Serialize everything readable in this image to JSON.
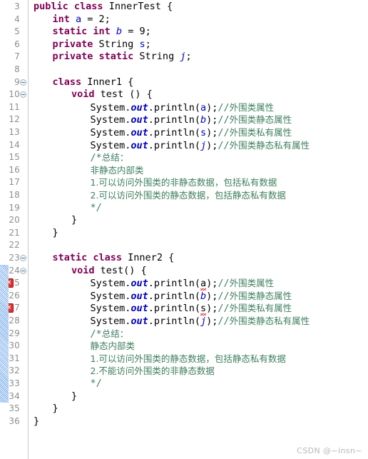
{
  "editor": {
    "language": "java",
    "first_line_number": 3,
    "last_line_number": 36,
    "colors": {
      "keyword": "#7f0055",
      "field": "#0000c0",
      "comment": "#3f7f5f",
      "error": "#e00000",
      "gutter_text": "#8e8e8e",
      "changebar": "#74a9e8",
      "background": "#ffffff"
    }
  },
  "lines": [
    {
      "n": "3",
      "fold": false,
      "error": false,
      "changed": false,
      "indent": 0,
      "tokens": [
        {
          "t": "kw",
          "v": "public"
        },
        {
          "t": "plain",
          "v": " "
        },
        {
          "t": "kw",
          "v": "class"
        },
        {
          "t": "plain",
          "v": " InnerTest {"
        }
      ]
    },
    {
      "n": "4",
      "fold": false,
      "error": false,
      "changed": false,
      "indent": 1,
      "tokens": [
        {
          "t": "kw",
          "v": "int"
        },
        {
          "t": "plain",
          "v": " "
        },
        {
          "t": "fld",
          "v": "a"
        },
        {
          "t": "plain",
          "v": " = 2;"
        }
      ]
    },
    {
      "n": "5",
      "fold": false,
      "error": false,
      "changed": false,
      "indent": 1,
      "tokens": [
        {
          "t": "kw",
          "v": "static int"
        },
        {
          "t": "plain",
          "v": " "
        },
        {
          "t": "sfld",
          "v": "b"
        },
        {
          "t": "plain",
          "v": " = 9;"
        }
      ]
    },
    {
      "n": "6",
      "fold": false,
      "error": false,
      "changed": false,
      "indent": 1,
      "tokens": [
        {
          "t": "kw",
          "v": "private"
        },
        {
          "t": "plain",
          "v": " String "
        },
        {
          "t": "fld",
          "v": "s"
        },
        {
          "t": "plain",
          "v": ";"
        }
      ]
    },
    {
      "n": "7",
      "fold": false,
      "error": false,
      "changed": false,
      "indent": 1,
      "tokens": [
        {
          "t": "kw",
          "v": "private static"
        },
        {
          "t": "plain",
          "v": " String "
        },
        {
          "t": "sfld",
          "v": "j"
        },
        {
          "t": "plain",
          "v": ";"
        }
      ]
    },
    {
      "n": "8",
      "fold": false,
      "error": false,
      "changed": false,
      "indent": 0,
      "tokens": []
    },
    {
      "n": "9",
      "fold": true,
      "error": false,
      "changed": false,
      "indent": 1,
      "tokens": [
        {
          "t": "kw",
          "v": "class"
        },
        {
          "t": "plain",
          "v": " Inner1 {"
        }
      ]
    },
    {
      "n": "10",
      "fold": true,
      "error": false,
      "changed": false,
      "indent": 2,
      "tokens": [
        {
          "t": "kw",
          "v": "void"
        },
        {
          "t": "plain",
          "v": " test () {"
        }
      ]
    },
    {
      "n": "11",
      "fold": false,
      "error": false,
      "changed": false,
      "indent": 3,
      "tokens": [
        {
          "t": "plain",
          "v": "System."
        },
        {
          "t": "mfld",
          "v": "out"
        },
        {
          "t": "plain",
          "v": ".println("
        },
        {
          "t": "fld",
          "v": "a"
        },
        {
          "t": "plain",
          "v": ");"
        },
        {
          "t": "cmtm",
          "v": "//"
        },
        {
          "t": "cmt",
          "v": "外围类属性"
        }
      ]
    },
    {
      "n": "12",
      "fold": false,
      "error": false,
      "changed": false,
      "indent": 3,
      "tokens": [
        {
          "t": "plain",
          "v": "System."
        },
        {
          "t": "mfld",
          "v": "out"
        },
        {
          "t": "plain",
          "v": ".println("
        },
        {
          "t": "sfld",
          "v": "b"
        },
        {
          "t": "plain",
          "v": ");"
        },
        {
          "t": "cmtm",
          "v": "//"
        },
        {
          "t": "cmt",
          "v": "外围类静态属性"
        }
      ]
    },
    {
      "n": "13",
      "fold": false,
      "error": false,
      "changed": false,
      "indent": 3,
      "tokens": [
        {
          "t": "plain",
          "v": "System."
        },
        {
          "t": "mfld",
          "v": "out"
        },
        {
          "t": "plain",
          "v": ".println("
        },
        {
          "t": "fld",
          "v": "s"
        },
        {
          "t": "plain",
          "v": ");"
        },
        {
          "t": "cmtm",
          "v": "//"
        },
        {
          "t": "cmt",
          "v": "外围类私有属性"
        }
      ]
    },
    {
      "n": "14",
      "fold": false,
      "error": false,
      "changed": false,
      "indent": 3,
      "tokens": [
        {
          "t": "plain",
          "v": "System."
        },
        {
          "t": "mfld",
          "v": "out"
        },
        {
          "t": "plain",
          "v": ".println("
        },
        {
          "t": "sfld",
          "v": "j"
        },
        {
          "t": "plain",
          "v": ");"
        },
        {
          "t": "cmtm",
          "v": "//"
        },
        {
          "t": "cmt",
          "v": "外围类静态私有属性"
        }
      ]
    },
    {
      "n": "15",
      "fold": false,
      "error": false,
      "changed": false,
      "indent": 3,
      "tokens": [
        {
          "t": "cmtm",
          "v": "/*"
        },
        {
          "t": "cmt",
          "v": "总结："
        }
      ]
    },
    {
      "n": "16",
      "fold": false,
      "error": false,
      "changed": false,
      "indent": 3,
      "tokens": [
        {
          "t": "cmt",
          "v": "非静态内部类"
        }
      ]
    },
    {
      "n": "17",
      "fold": false,
      "error": false,
      "changed": false,
      "indent": 3,
      "tokens": [
        {
          "t": "cmt",
          "v": "1.可以访问外围类的非静态数据，包括私有数据"
        }
      ]
    },
    {
      "n": "18",
      "fold": false,
      "error": false,
      "changed": false,
      "indent": 3,
      "tokens": [
        {
          "t": "cmt",
          "v": "2.可以访问外围类的静态数据，包括静态私有数据"
        }
      ]
    },
    {
      "n": "19",
      "fold": false,
      "error": false,
      "changed": false,
      "indent": 3,
      "tokens": [
        {
          "t": "cmtm",
          "v": "*/"
        }
      ]
    },
    {
      "n": "20",
      "fold": false,
      "error": false,
      "changed": false,
      "indent": 2,
      "tokens": [
        {
          "t": "plain",
          "v": "}"
        }
      ]
    },
    {
      "n": "21",
      "fold": false,
      "error": false,
      "changed": false,
      "indent": 1,
      "tokens": [
        {
          "t": "plain",
          "v": "}"
        }
      ]
    },
    {
      "n": "22",
      "fold": false,
      "error": false,
      "changed": false,
      "indent": 0,
      "tokens": []
    },
    {
      "n": "23",
      "fold": true,
      "error": false,
      "changed": false,
      "indent": 1,
      "tokens": [
        {
          "t": "kw",
          "v": "static class"
        },
        {
          "t": "plain",
          "v": " Inner2 {"
        }
      ]
    },
    {
      "n": "24",
      "fold": true,
      "error": false,
      "changed": true,
      "indent": 2,
      "tokens": [
        {
          "t": "kw",
          "v": "void"
        },
        {
          "t": "plain",
          "v": " test() {"
        }
      ]
    },
    {
      "n": "25",
      "fold": false,
      "error": true,
      "changed": true,
      "indent": 3,
      "tokens": [
        {
          "t": "plain",
          "v": "System."
        },
        {
          "t": "mfld",
          "v": "out"
        },
        {
          "t": "plain",
          "v": ".println("
        },
        {
          "t": "err",
          "v": "a"
        },
        {
          "t": "plain",
          "v": ");"
        },
        {
          "t": "cmtm",
          "v": "//"
        },
        {
          "t": "cmt",
          "v": "外围类属性"
        }
      ]
    },
    {
      "n": "26",
      "fold": false,
      "error": false,
      "changed": true,
      "indent": 3,
      "tokens": [
        {
          "t": "plain",
          "v": "System."
        },
        {
          "t": "mfld",
          "v": "out"
        },
        {
          "t": "plain",
          "v": ".println("
        },
        {
          "t": "sfld",
          "v": "b"
        },
        {
          "t": "plain",
          "v": ");"
        },
        {
          "t": "cmtm",
          "v": "//"
        },
        {
          "t": "cmt",
          "v": "外围类静态属性"
        }
      ]
    },
    {
      "n": "27",
      "fold": false,
      "error": true,
      "changed": true,
      "indent": 3,
      "tokens": [
        {
          "t": "plain",
          "v": "System."
        },
        {
          "t": "mfld",
          "v": "out"
        },
        {
          "t": "plain",
          "v": ".println("
        },
        {
          "t": "err",
          "v": "s"
        },
        {
          "t": "plain",
          "v": ");"
        },
        {
          "t": "cmtm",
          "v": "//"
        },
        {
          "t": "cmt",
          "v": "外围类私有属性"
        }
      ]
    },
    {
      "n": "28",
      "fold": false,
      "error": false,
      "changed": true,
      "indent": 3,
      "tokens": [
        {
          "t": "plain",
          "v": "System."
        },
        {
          "t": "mfld",
          "v": "out"
        },
        {
          "t": "plain",
          "v": ".println("
        },
        {
          "t": "sfld",
          "v": "j"
        },
        {
          "t": "plain",
          "v": ");"
        },
        {
          "t": "cmtm",
          "v": "//"
        },
        {
          "t": "cmt",
          "v": "外围类静态私有属性"
        }
      ]
    },
    {
      "n": "29",
      "fold": false,
      "error": false,
      "changed": true,
      "indent": 3,
      "tokens": [
        {
          "t": "cmtm",
          "v": "/*"
        },
        {
          "t": "cmt",
          "v": "总结："
        }
      ]
    },
    {
      "n": "30",
      "fold": false,
      "error": false,
      "changed": true,
      "indent": 3,
      "tokens": [
        {
          "t": "cmt",
          "v": "静态内部类"
        }
      ]
    },
    {
      "n": "31",
      "fold": false,
      "error": false,
      "changed": true,
      "indent": 3,
      "tokens": [
        {
          "t": "cmt",
          "v": "1.可以访问外围类的静态数据，包括静态私有数据"
        }
      ]
    },
    {
      "n": "32",
      "fold": false,
      "error": false,
      "changed": true,
      "indent": 3,
      "tokens": [
        {
          "t": "cmt",
          "v": "2.不能访问外围类的非静态数据"
        }
      ]
    },
    {
      "n": "33",
      "fold": false,
      "error": false,
      "changed": true,
      "indent": 3,
      "tokens": [
        {
          "t": "cmtm",
          "v": "*/"
        }
      ]
    },
    {
      "n": "34",
      "fold": false,
      "error": false,
      "changed": true,
      "indent": 2,
      "tokens": [
        {
          "t": "plain",
          "v": "}"
        }
      ]
    },
    {
      "n": "35",
      "fold": false,
      "error": false,
      "changed": false,
      "indent": 1,
      "tokens": [
        {
          "t": "plain",
          "v": "}"
        }
      ]
    },
    {
      "n": "36",
      "fold": false,
      "error": false,
      "changed": false,
      "indent": 0,
      "tokens": [
        {
          "t": "plain",
          "v": "}"
        }
      ]
    }
  ],
  "watermark": {
    "text": "CSDN @~insn~"
  }
}
